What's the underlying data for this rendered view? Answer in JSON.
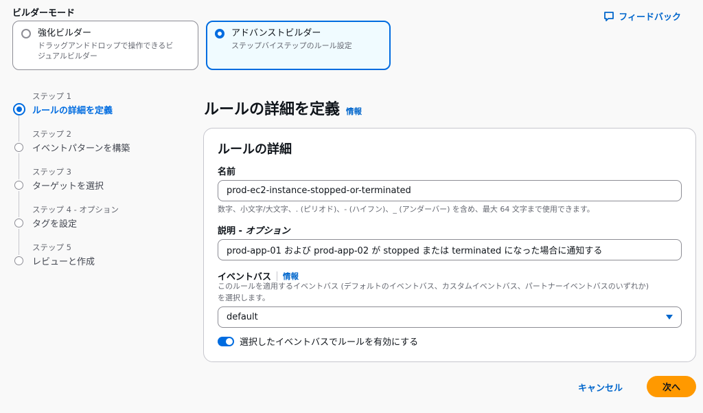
{
  "builder_mode": {
    "title": "ビルダーモード",
    "feedback_label": "フィードバック",
    "options": [
      {
        "title": "強化ビルダー",
        "desc_line1": "ドラッグアンドドロップで操作できるビ",
        "desc_line2": "ジュアルビルダー",
        "selected": false
      },
      {
        "title": "アドバンストビルダー",
        "desc_line1": "ステップバイステップのルール設定",
        "desc_line2": "",
        "selected": true
      }
    ]
  },
  "steps": [
    {
      "label": "ステップ 1",
      "name": "ルールの詳細を定義",
      "active": true
    },
    {
      "label": "ステップ 2",
      "name": "イベントパターンを構築",
      "active": false
    },
    {
      "label": "ステップ 3",
      "name": "ターゲットを選択",
      "active": false
    },
    {
      "label": "ステップ 4 - オプション",
      "name": "タグを設定",
      "active": false
    },
    {
      "label": "ステップ 5",
      "name": "レビューと作成",
      "active": false
    }
  ],
  "page": {
    "title": "ルールの詳細を定義",
    "info_label": "情報"
  },
  "panel": {
    "title": "ルールの詳細",
    "name_label": "名前",
    "name_value": "prod-ec2-instance-stopped-or-terminated",
    "name_hint": "数字、小文字/大文字、. (ピリオド)、- (ハイフン)、_ (アンダーバー) を含め、最大 64 文字まで使用できます。",
    "desc_label": "説明 - ",
    "desc_label_optional": "オプション",
    "desc_value": "prod-app-01 および prod-app-02 が stopped または terminated になった場合に通知する",
    "bus_label": "イベントバス",
    "bus_info": "情報",
    "bus_hint_line1": "このルールを適用するイベントバス (デフォルトのイベントバス、カスタムイベントバス、パートナーイベントバスのいずれか)",
    "bus_hint_line2": "を選択します。",
    "bus_value": "default",
    "toggle_label": "選択したイベントバスでルールを有効にする",
    "toggle_on": true
  },
  "footer": {
    "cancel_label": "キャンセル",
    "next_label": "次へ"
  },
  "colors": {
    "accent": "#006ce0",
    "primary_button": "#ff9900",
    "link": "#0066cc"
  }
}
